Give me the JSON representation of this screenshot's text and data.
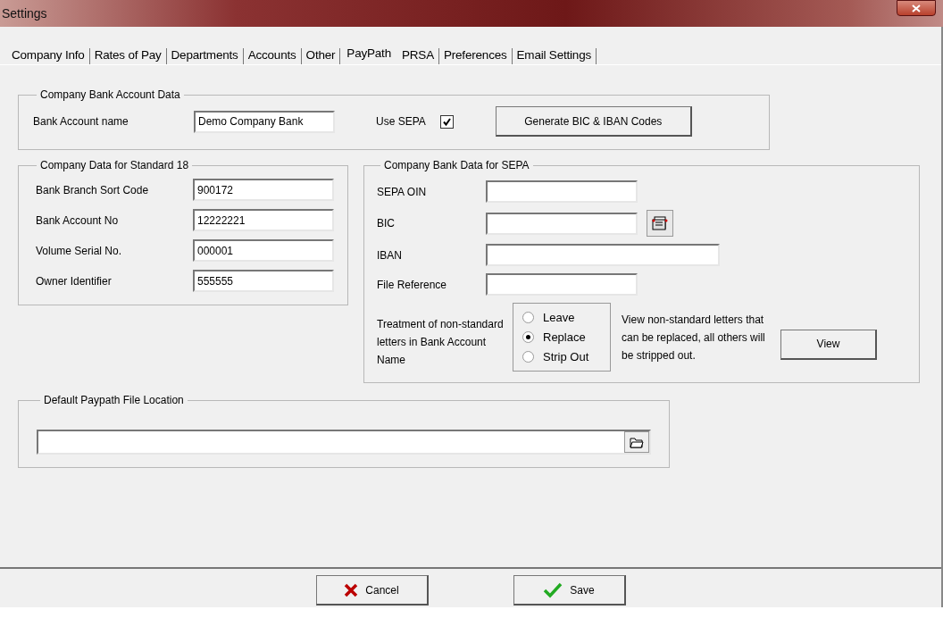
{
  "window": {
    "title": "Settings"
  },
  "tabs": [
    {
      "label": "Company Info",
      "selected": false
    },
    {
      "label": "Rates of Pay",
      "selected": false
    },
    {
      "label": "Departments",
      "selected": false
    },
    {
      "label": "Accounts",
      "selected": false
    },
    {
      "label": "Other",
      "selected": false
    },
    {
      "label": "PayPath",
      "selected": true
    },
    {
      "label": "PRSA",
      "selected": false
    },
    {
      "label": "Preferences",
      "selected": false
    },
    {
      "label": "Email Settings",
      "selected": false
    }
  ],
  "company_bank_account": {
    "title": "Company Bank Account Data",
    "name_label": "Bank Account name",
    "name_value": "Demo Company Bank",
    "use_sepa": {
      "label": "Use SEPA",
      "checked": true
    },
    "generate_button": "Generate BIC & IBAN Codes"
  },
  "standard_18": {
    "title": "Company Data for Standard 18",
    "fields": [
      {
        "label": "Bank Branch Sort Code",
        "value": "900172"
      },
      {
        "label": "Bank Account No",
        "value": "12222221"
      },
      {
        "label": "Volume Serial No.",
        "value": "000001"
      },
      {
        "label": "Owner Identifier",
        "value": "555555"
      }
    ]
  },
  "sepa": {
    "title": "Company Bank Data for SEPA",
    "fields": [
      {
        "label": "SEPA OIN",
        "kind": "short"
      },
      {
        "label": "BIC",
        "kind": "lookup"
      },
      {
        "label": "IBAN",
        "kind": "long"
      },
      {
        "label": "File Reference",
        "kind": "short"
      }
    ],
    "treatment_label": "Treatment of non-standard letters in Bank Account Name",
    "options": [
      {
        "label": "Leave",
        "selected": false
      },
      {
        "label": "Replace",
        "selected": true
      },
      {
        "label": "Strip Out",
        "selected": false
      }
    ],
    "note": "View non-standard letters that can be replaced, all others will be stripped out.",
    "view_button": "View"
  },
  "file_location": {
    "title": "Default Paypath File Location"
  },
  "buttons": [
    {
      "label": "Cancel",
      "kind": "cancel"
    },
    {
      "label": "Save",
      "kind": "save"
    }
  ]
}
